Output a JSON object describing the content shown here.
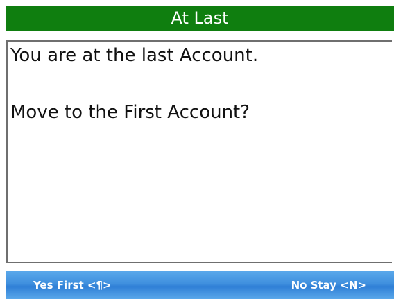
{
  "dialog": {
    "title": "At Last",
    "message_line_1": "You are at the last Account.",
    "message_line_2": "Move to the First Account?"
  },
  "softkeys": {
    "left_label": "Yes First <¶>",
    "right_label": "No Stay <N>"
  },
  "colors": {
    "title_bar": "#0f7e0f",
    "softkey_bar": "#3f8fde",
    "message_border": "#6f6f6f"
  }
}
